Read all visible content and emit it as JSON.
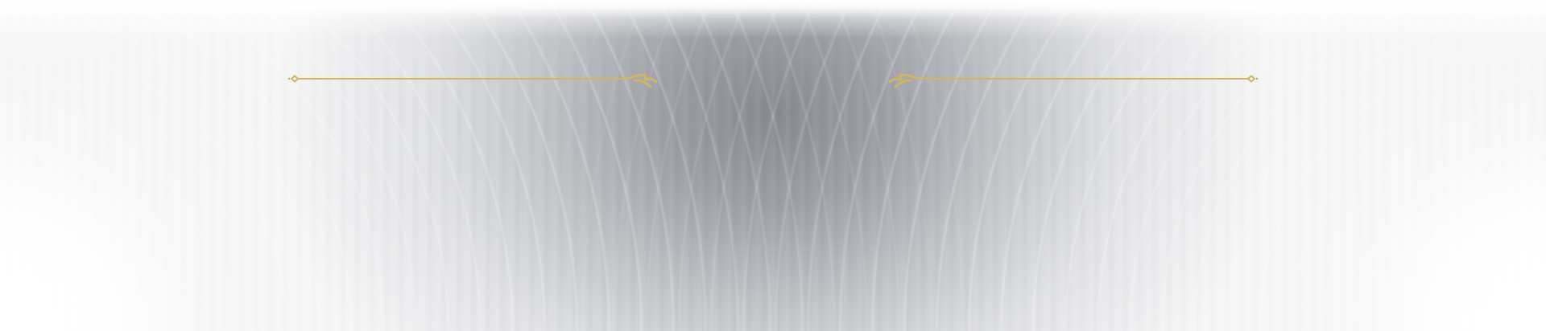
{
  "colors": {
    "ornament_gold": "#d2b461",
    "background_center": "#8a8d94",
    "background_edge": "#ffffff"
  },
  "decorations": {
    "left_ornament_icon": "flourish-line-icon",
    "right_ornament_icon": "flourish-line-icon"
  }
}
